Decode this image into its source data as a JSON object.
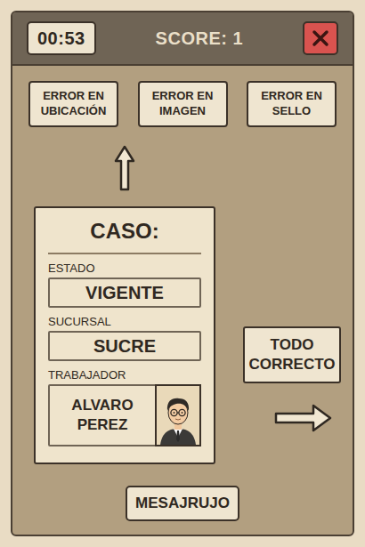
{
  "header": {
    "timer": "00:53",
    "score": "SCORE: 1"
  },
  "error_buttons": [
    "ERROR EN UBICACIÓN",
    "ERROR EN IMAGEN",
    "ERROR EN SELLO"
  ],
  "case": {
    "title": "CASO:",
    "fields": [
      {
        "label": "ESTADO",
        "value": "VIGENTE"
      },
      {
        "label": "SUCURSAL",
        "value": "SUCRE"
      }
    ],
    "worker": {
      "label": "TRABAJADOR",
      "name": "ALVARO PEREZ"
    }
  },
  "correct_button": "TODO CORRECTO",
  "bottom_button": "MESAJRUJO"
}
